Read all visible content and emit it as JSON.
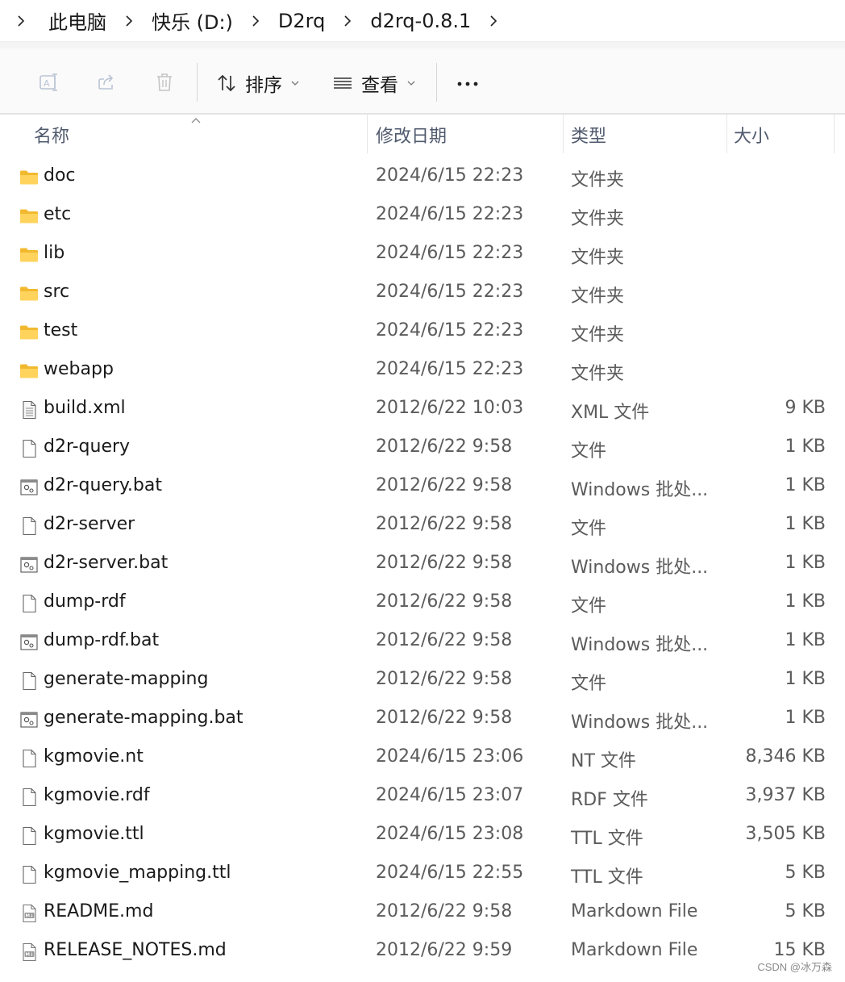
{
  "breadcrumb": {
    "items": [
      "此电脑",
      "快乐 (D:)",
      "D2rq",
      "d2rq-0.8.1"
    ]
  },
  "toolbar": {
    "sort_label": "排序",
    "view_label": "查看"
  },
  "columns": {
    "name": "名称",
    "date": "修改日期",
    "type": "类型",
    "size": "大小"
  },
  "files": [
    {
      "name": "doc",
      "date": "2024/6/15 22:23",
      "type": "文件夹",
      "size": "",
      "icon": "folder-icon"
    },
    {
      "name": "etc",
      "date": "2024/6/15 22:23",
      "type": "文件夹",
      "size": "",
      "icon": "folder-icon"
    },
    {
      "name": "lib",
      "date": "2024/6/15 22:23",
      "type": "文件夹",
      "size": "",
      "icon": "folder-icon"
    },
    {
      "name": "src",
      "date": "2024/6/15 22:23",
      "type": "文件夹",
      "size": "",
      "icon": "folder-icon"
    },
    {
      "name": "test",
      "date": "2024/6/15 22:23",
      "type": "文件夹",
      "size": "",
      "icon": "folder-icon"
    },
    {
      "name": "webapp",
      "date": "2024/6/15 22:23",
      "type": "文件夹",
      "size": "",
      "icon": "folder-icon"
    },
    {
      "name": "build.xml",
      "date": "2012/6/22 10:03",
      "type": "XML 文件",
      "size": "9 KB",
      "icon": "xml-file-icon"
    },
    {
      "name": "d2r-query",
      "date": "2012/6/22 9:58",
      "type": "文件",
      "size": "1 KB",
      "icon": "blank-file-icon"
    },
    {
      "name": "d2r-query.bat",
      "date": "2012/6/22 9:58",
      "type": "Windows 批处...",
      "size": "1 KB",
      "icon": "batch-file-icon"
    },
    {
      "name": "d2r-server",
      "date": "2012/6/22 9:58",
      "type": "文件",
      "size": "1 KB",
      "icon": "blank-file-icon"
    },
    {
      "name": "d2r-server.bat",
      "date": "2012/6/22 9:58",
      "type": "Windows 批处...",
      "size": "1 KB",
      "icon": "batch-file-icon"
    },
    {
      "name": "dump-rdf",
      "date": "2012/6/22 9:58",
      "type": "文件",
      "size": "1 KB",
      "icon": "blank-file-icon"
    },
    {
      "name": "dump-rdf.bat",
      "date": "2012/6/22 9:58",
      "type": "Windows 批处...",
      "size": "1 KB",
      "icon": "batch-file-icon"
    },
    {
      "name": "generate-mapping",
      "date": "2012/6/22 9:58",
      "type": "文件",
      "size": "1 KB",
      "icon": "blank-file-icon"
    },
    {
      "name": "generate-mapping.bat",
      "date": "2012/6/22 9:58",
      "type": "Windows 批处...",
      "size": "1 KB",
      "icon": "batch-file-icon"
    },
    {
      "name": "kgmovie.nt",
      "date": "2024/6/15 23:06",
      "type": "NT 文件",
      "size": "8,346 KB",
      "icon": "blank-file-icon"
    },
    {
      "name": "kgmovie.rdf",
      "date": "2024/6/15 23:07",
      "type": "RDF 文件",
      "size": "3,937 KB",
      "icon": "blank-file-icon"
    },
    {
      "name": "kgmovie.ttl",
      "date": "2024/6/15 23:08",
      "type": "TTL 文件",
      "size": "3,505 KB",
      "icon": "blank-file-icon"
    },
    {
      "name": "kgmovie_mapping.ttl",
      "date": "2024/6/15 22:55",
      "type": "TTL 文件",
      "size": "5 KB",
      "icon": "blank-file-icon"
    },
    {
      "name": "README.md",
      "date": "2012/6/22 9:58",
      "type": "Markdown File",
      "size": "5 KB",
      "icon": "markdown-file-icon"
    },
    {
      "name": "RELEASE_NOTES.md",
      "date": "2012/6/22 9:59",
      "type": "Markdown File",
      "size": "15 KB",
      "icon": "markdown-file-icon"
    }
  ],
  "watermark": "CSDN @冰万森",
  "colors": {
    "folder": "#f4c13b",
    "header_text": "#505a6e",
    "secondary_text": "#5b5b5b"
  }
}
